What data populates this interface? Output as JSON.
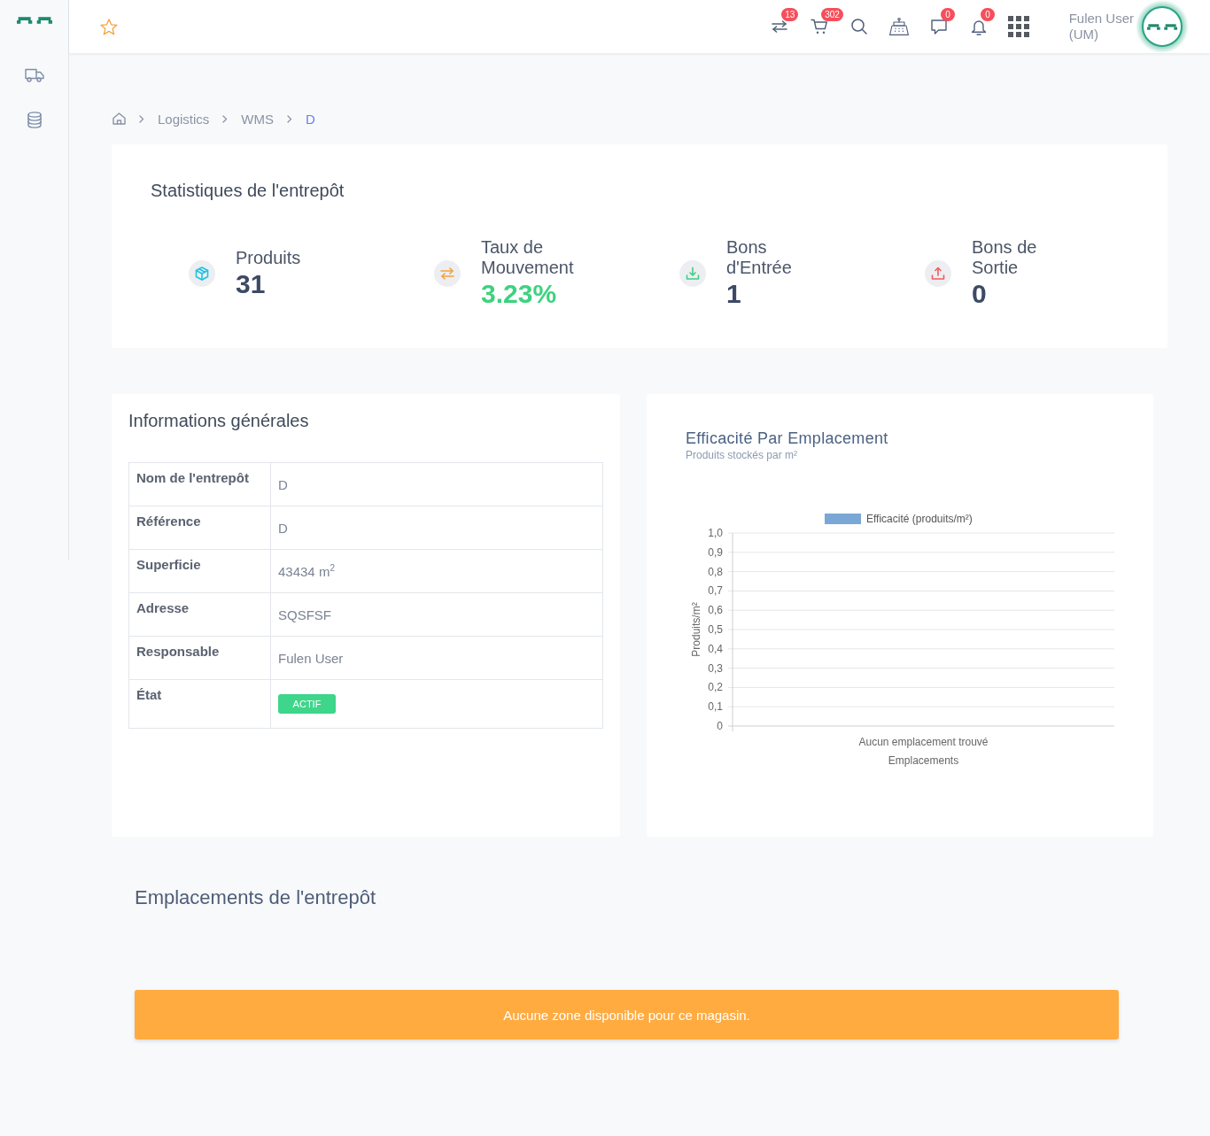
{
  "sidebar": {
    "items": [
      {
        "kind": "truck"
      },
      {
        "kind": "database"
      }
    ]
  },
  "top_bar": {
    "actions": [
      {
        "kind": "transfers",
        "badge": "13"
      },
      {
        "kind": "cart",
        "badge": "302"
      },
      {
        "kind": "search"
      },
      {
        "kind": "register"
      },
      {
        "kind": "messages",
        "badge": "0"
      },
      {
        "kind": "notifications",
        "badge": "0"
      },
      {
        "kind": "apps"
      }
    ],
    "user": {
      "name": "Fulen User",
      "role": "(UM)"
    }
  },
  "breadcrumb": {
    "items": [
      {
        "label": "Logistics",
        "current": false
      },
      {
        "label": "WMS",
        "current": false
      },
      {
        "label": "D",
        "current": true
      }
    ]
  },
  "stats": {
    "title": "Statistiques de l'entrepôt",
    "items": [
      {
        "kind": "products",
        "label": "Produits",
        "value": "31"
      },
      {
        "kind": "movement",
        "label": "Taux de Mouvement",
        "value": "3.23%"
      },
      {
        "kind": "inbound",
        "label": "Bons d'Entrée",
        "value": "1"
      },
      {
        "kind": "outbound",
        "label": "Bons de Sortie",
        "value": "0"
      }
    ]
  },
  "general_info": {
    "title": "Informations générales",
    "rows": [
      {
        "kind": "text",
        "label": "Nom de l'entrepôt",
        "value": "D"
      },
      {
        "kind": "text",
        "label": "Référence",
        "value": "D"
      },
      {
        "kind": "text",
        "label": "Superficie",
        "value": "43434 m$^{2}$"
      },
      {
        "kind": "text",
        "label": "Adresse",
        "value": "SQSFSF"
      },
      {
        "kind": "text",
        "label": "Responsable",
        "value": "Fulen User"
      },
      {
        "kind": "badge",
        "label": "État",
        "value": "ACTIF",
        "active": true
      }
    ]
  },
  "efficiency": {
    "title": "Efficacité Par Emplacement",
    "subtitle": "Produits stockés par m²",
    "chart_data": {
      "type": "bar",
      "grid": true,
      "xlabel": "Emplacements",
      "ylabel": "Produits/m²",
      "categories": [
        "Aucun emplacement trouvé"
      ],
      "series": [
        {
          "name": "Efficacité (produits/m²)",
          "color": "#7ba7d6",
          "values": [
            null
          ]
        }
      ],
      "ylim": [
        0,
        1
      ],
      "yticks": [
        {
          "value": 0,
          "label": "0"
        },
        {
          "value": 0.1,
          "label": "0,1"
        },
        {
          "value": 0.2,
          "label": "0,2"
        },
        {
          "value": 0.3,
          "label": "0,3"
        },
        {
          "value": 0.4,
          "label": "0,4"
        },
        {
          "value": 0.5,
          "label": "0,5"
        },
        {
          "value": 0.6,
          "label": "0,6"
        },
        {
          "value": 0.7,
          "label": "0,7"
        },
        {
          "value": 0.8,
          "label": "0,8"
        },
        {
          "value": 0.9,
          "label": "0,9"
        },
        {
          "value": 1,
          "label": "1,0"
        }
      ]
    }
  },
  "locations": {
    "title": "Emplacements de l'entrepôt",
    "alert": "Aucune zone disponible pour ce magasin."
  }
}
